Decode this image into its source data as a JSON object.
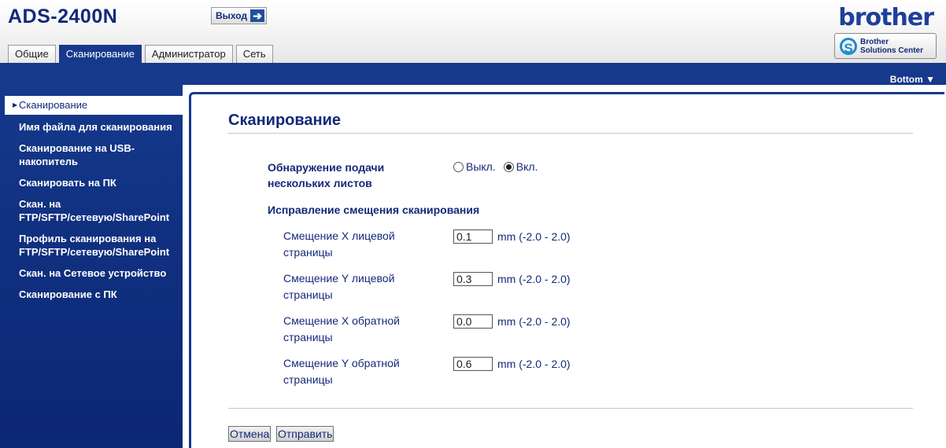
{
  "header": {
    "model": "ADS-2400N",
    "logout_label": "Выход",
    "logout_icon": "arrow-right-icon",
    "brand": "brother",
    "solutions_line1": "Brother",
    "solutions_line2": "Solutions Center"
  },
  "tabs": [
    {
      "label": "Общие",
      "active": false
    },
    {
      "label": "Сканирование",
      "active": true
    },
    {
      "label": "Администратор",
      "active": false
    },
    {
      "label": "Сеть",
      "active": false
    }
  ],
  "bottom_link": "Bottom ▼",
  "sidebar": {
    "active": "Сканирование",
    "items": [
      "Имя файла для сканирования",
      "Сканирование на USB-\nнакопитель",
      "Сканировать на ПК",
      "Скан. на\nFTP/SFTP/сетевую/SharePoint",
      "Профиль сканирования на\nFTP/SFTP/сетевую/SharePoint",
      "Скан. на Сетевое устройство",
      "Сканирование с ПК"
    ]
  },
  "main": {
    "title": "Сканирование",
    "multifeed": {
      "label_line1": "Обнаружение подачи",
      "label_line2": "нескольких листов",
      "off_label": "Выкл.",
      "on_label": "Вкл.",
      "selected": "Вкл."
    },
    "offset_heading": "Исправление смещения сканирования",
    "offsets": [
      {
        "line1": "Смещение X лицевой",
        "line2": "страницы",
        "value": "0.1",
        "unit": "mm (-2.0 - 2.0)"
      },
      {
        "line1": "Смещение Y лицевой",
        "line2": "страницы",
        "value": "0.3",
        "unit": "mm (-2.0 - 2.0)"
      },
      {
        "line1": "Смещение X обратной",
        "line2": "страницы",
        "value": "0.0",
        "unit": "mm (-2.0 - 2.0)"
      },
      {
        "line1": "Смещение Y обратной",
        "line2": "страницы",
        "value": "0.6",
        "unit": "mm (-2.0 - 2.0)"
      }
    ],
    "cancel_label": "Отмена",
    "submit_label": "Отправить"
  },
  "colors": {
    "primary": "#16398c",
    "text": "#14297a",
    "accent": "#1b8bd0"
  }
}
